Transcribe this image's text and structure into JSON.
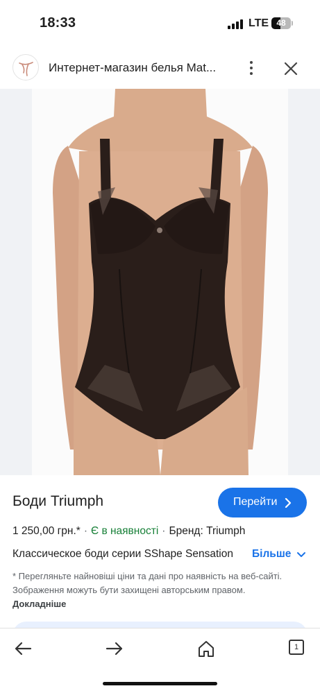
{
  "status_bar": {
    "time": "18:33",
    "network": "LTE",
    "battery_level": "48",
    "battery_fraction": 0.48
  },
  "header": {
    "title": "Интернет-магазин белья Mat..."
  },
  "product": {
    "title": "Боди Triumph",
    "go_label": "Перейти",
    "price": "1 250,00 грн.*",
    "separator": "·",
    "stock": "Є в наявності",
    "brand": "Бренд: Triumph",
    "description": "Классическое боди серии SShape Sensation",
    "more_label": "Більше",
    "disclaimer": "* Перегляньте найновіші ціни та дані про наявність на веб-сайті. Зображення можуть бути захищені авторським правом.",
    "details_link": "Докладніше"
  },
  "bottom_nav": {
    "tab_count": "1"
  },
  "colors": {
    "accent": "#1a73e8",
    "stock_green": "#188038",
    "garment": "#2a1e1a",
    "skin": "#d6a88a"
  }
}
